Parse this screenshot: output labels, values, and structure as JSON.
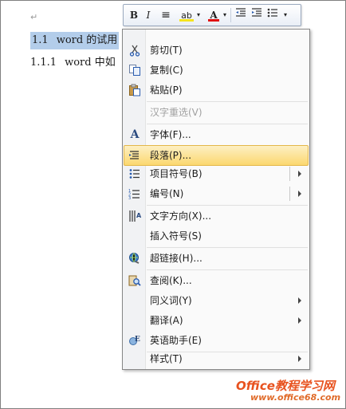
{
  "document": {
    "paragraph_mark": "↵",
    "heading1": {
      "number": "1.1",
      "text": "word 的试用"
    },
    "heading2": {
      "number": "1.1.1",
      "text": "word 中如"
    }
  },
  "mini_toolbar": {
    "bold": "B",
    "italic": "I",
    "center": "≡",
    "highlight": "ab",
    "font_color": "A",
    "colors": {
      "highlight": "#f5e41c",
      "font_color": "#e01010"
    }
  },
  "menu": {
    "items": [
      {
        "label": "剪切(T)",
        "icon": "scissors-icon"
      },
      {
        "label": "复制(C)",
        "icon": "copy-icon"
      },
      {
        "label": "粘贴(P)",
        "icon": "paste-icon"
      },
      {
        "label": "汉字重选(V)",
        "disabled": true
      },
      {
        "label": "字体(F)...",
        "icon": "font-icon"
      },
      {
        "label": "段落(P)...",
        "icon": "paragraph-icon",
        "active": true
      },
      {
        "label": "项目符号(B)",
        "icon": "bullets-icon",
        "submenu": true
      },
      {
        "label": "编号(N)",
        "icon": "numbering-icon",
        "submenu": true
      },
      {
        "label": "文字方向(X)...",
        "icon": "text-direction-icon"
      },
      {
        "label": "插入符号(S)"
      },
      {
        "label": "超链接(H)...",
        "icon": "hyperlink-icon"
      },
      {
        "label": "查阅(K)...",
        "icon": "research-icon"
      },
      {
        "label": "同义词(Y)",
        "submenu": true
      },
      {
        "label": "翻译(A)",
        "submenu": true
      },
      {
        "label": "英语助手(E)",
        "icon": "english-assistant-icon"
      },
      {
        "label": "样式(T)",
        "submenu": true
      }
    ],
    "colors": {
      "active_bg": "#fbd86f",
      "active_border": "#e3b749"
    }
  },
  "watermark": {
    "title": "Office教程学习网",
    "url": "www.office68.com"
  }
}
